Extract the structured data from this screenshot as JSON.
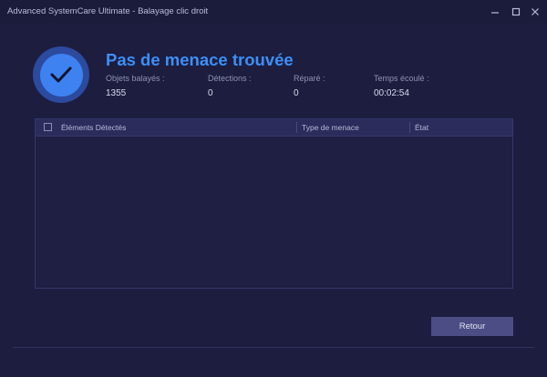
{
  "window": {
    "title": "Advanced SystemCare Ultimate - Balayage clic droit"
  },
  "result": {
    "headline": "Pas de menace trouvée",
    "icon": "check-icon",
    "accent_color": "#3d8ff5"
  },
  "stats": [
    {
      "label": "Objets balayés :",
      "value": "1355"
    },
    {
      "label": "Détections :",
      "value": "0"
    },
    {
      "label": "Réparé :",
      "value": "0"
    },
    {
      "label": "Temps écoulé :",
      "value": "00:02:54"
    }
  ],
  "table": {
    "columns": [
      "Éléments Détectés",
      "Type de menace",
      "État"
    ],
    "rows": []
  },
  "actions": {
    "return_label": "Retour"
  }
}
